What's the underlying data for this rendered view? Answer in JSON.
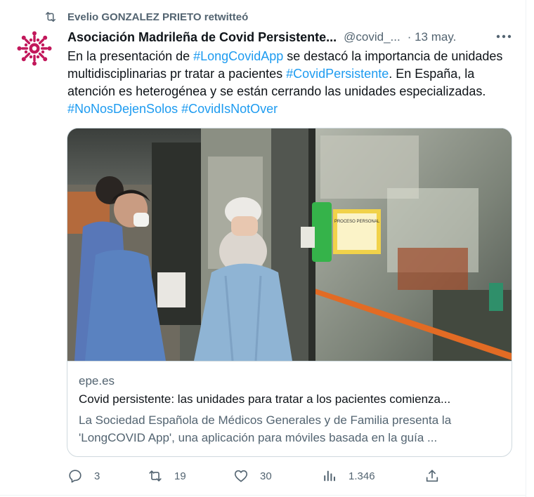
{
  "retweet_banner": {
    "text": "Evelio GONZALEZ PRIETO retwitteó"
  },
  "tweet": {
    "author_name": "Asociación Madrileña de Covid Persistente...",
    "handle": "@covid_...",
    "time": "· 13 may.",
    "more_label": "•••",
    "text": {
      "t1": "En la presentación de ",
      "h1": "#LongCovidApp",
      "t2": " se destacó la importancia de unidades multidisciplinarias pr tratar a pacientes ",
      "h2": "#CovidPersistente",
      "t3": ". En España, la atención es heterogénea y se están cerrando las unidades especializadas. ",
      "h3": "#NoNosDejenSolos",
      "t4": " ",
      "h4": "#CovidIsNotOver"
    }
  },
  "card": {
    "domain": "epe.es",
    "title": "Covid persistente: las unidades para tratar a los pacientes comienza...",
    "description": "La Sociedad Española de Médicos Generales y de Familia presenta la 'LongCOVID App', una aplicación para móviles basada en la guía ...",
    "image_sign_text": "PROCESO PERSONAL"
  },
  "actions": {
    "replies": "3",
    "retweets": "19",
    "likes": "30",
    "views": "1.346"
  },
  "colors": {
    "accent": "#1d9bf0",
    "secondary_text": "#536471",
    "avatar_brand": "#c2185b"
  },
  "icons": [
    "retweet-icon",
    "more-icon",
    "reply-icon",
    "like-icon",
    "views-icon",
    "share-icon"
  ]
}
